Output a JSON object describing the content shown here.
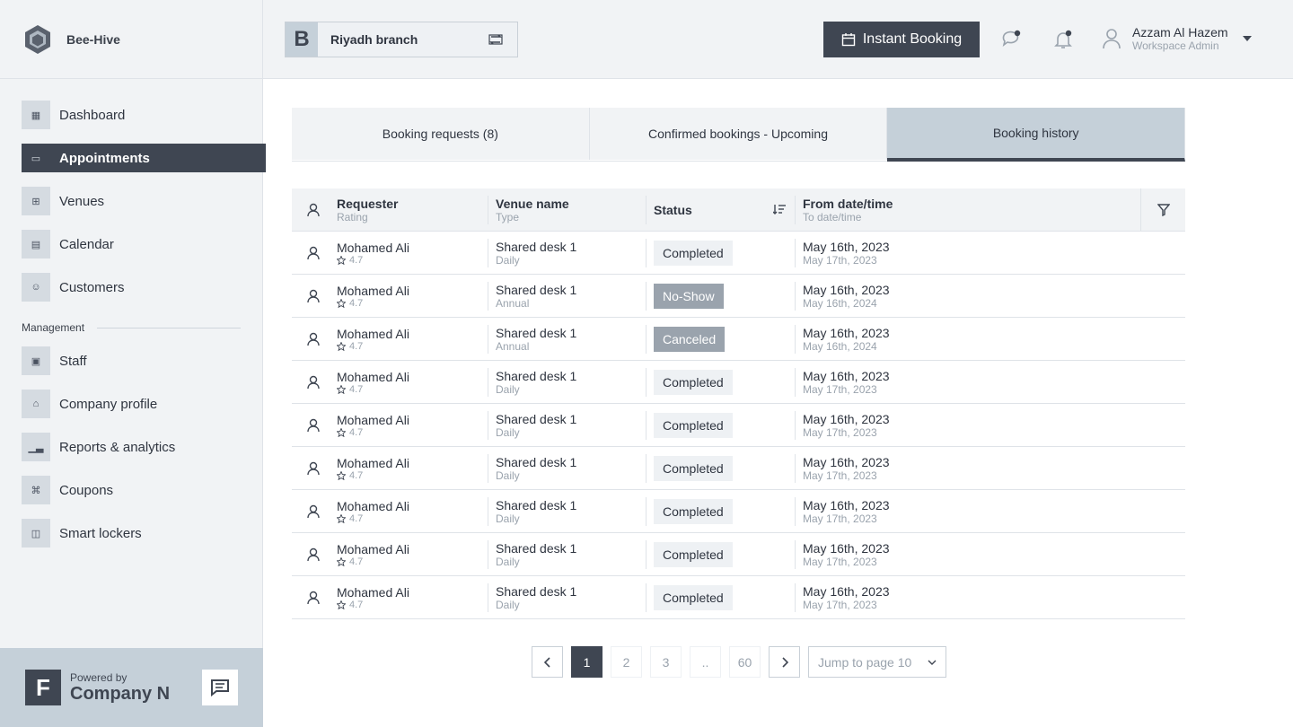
{
  "app": {
    "name": "Bee-Hive"
  },
  "sidebar": {
    "items": [
      {
        "label": "Dashboard",
        "icon": "dashboard-icon"
      },
      {
        "label": "Appointments",
        "icon": "appointments-icon",
        "active": true
      },
      {
        "label": "Venues",
        "icon": "venues-icon"
      },
      {
        "label": "Calendar",
        "icon": "calendar-icon"
      },
      {
        "label": "Customers",
        "icon": "customers-icon"
      }
    ],
    "section_label": "Management",
    "management_items": [
      {
        "label": "Staff",
        "icon": "staff-icon"
      },
      {
        "label": "Company profile",
        "icon": "company-icon"
      },
      {
        "label": "Reports & analytics",
        "icon": "reports-icon"
      },
      {
        "label": "Coupons",
        "icon": "coupons-icon"
      },
      {
        "label": "Smart lockers",
        "icon": "lockers-icon"
      }
    ],
    "powered_by": "Powered by",
    "company": "Company N",
    "company_initial": "F"
  },
  "header": {
    "branch_initial": "B",
    "branch_name": "Riyadh branch",
    "instant_booking": "Instant Booking",
    "user_name": "Azzam Al Hazem",
    "user_role": "Workspace Admin"
  },
  "tabs": [
    {
      "label": "Booking requests (8)"
    },
    {
      "label": "Confirmed bookings - Upcoming"
    },
    {
      "label": "Booking history",
      "active": true
    }
  ],
  "table": {
    "headers": {
      "requester": "Requester",
      "rating": "Rating",
      "venue": "Venue name",
      "type": "Type",
      "status": "Status",
      "from": "From date/time",
      "to": "To date/time"
    },
    "rows": [
      {
        "name": "Mohamed Ali",
        "rating": "4.7",
        "venue": "Shared desk 1",
        "type": "Daily",
        "status": "Completed",
        "from": "May 16th, 2023",
        "to": "May 17th, 2023"
      },
      {
        "name": "Mohamed Ali",
        "rating": "4.7",
        "venue": "Shared desk 1",
        "type": "Annual",
        "status": "No-Show",
        "from": "May 16th, 2023",
        "to": "May 16th, 2024"
      },
      {
        "name": "Mohamed Ali",
        "rating": "4.7",
        "venue": "Shared desk 1",
        "type": "Annual",
        "status": "Canceled",
        "from": "May 16th, 2023",
        "to": "May 16th, 2024"
      },
      {
        "name": "Mohamed Ali",
        "rating": "4.7",
        "venue": "Shared desk 1",
        "type": "Daily",
        "status": "Completed",
        "from": "May 16th, 2023",
        "to": "May 17th, 2023"
      },
      {
        "name": "Mohamed Ali",
        "rating": "4.7",
        "venue": "Shared desk 1",
        "type": "Daily",
        "status": "Completed",
        "from": "May 16th, 2023",
        "to": "May 17th, 2023"
      },
      {
        "name": "Mohamed Ali",
        "rating": "4.7",
        "venue": "Shared desk 1",
        "type": "Daily",
        "status": "Completed",
        "from": "May 16th, 2023",
        "to": "May 17th, 2023"
      },
      {
        "name": "Mohamed Ali",
        "rating": "4.7",
        "venue": "Shared desk 1",
        "type": "Daily",
        "status": "Completed",
        "from": "May 16th, 2023",
        "to": "May 17th, 2023"
      },
      {
        "name": "Mohamed Ali",
        "rating": "4.7",
        "venue": "Shared desk 1",
        "type": "Daily",
        "status": "Completed",
        "from": "May 16th, 2023",
        "to": "May 17th, 2023"
      },
      {
        "name": "Mohamed Ali",
        "rating": "4.7",
        "venue": "Shared desk 1",
        "type": "Daily",
        "status": "Completed",
        "from": "May 16th, 2023",
        "to": "May 17th, 2023"
      }
    ]
  },
  "pagination": {
    "pages": [
      "1",
      "2",
      "3",
      "..",
      "60"
    ],
    "current": "1",
    "jump_label": "Jump to page 10"
  }
}
